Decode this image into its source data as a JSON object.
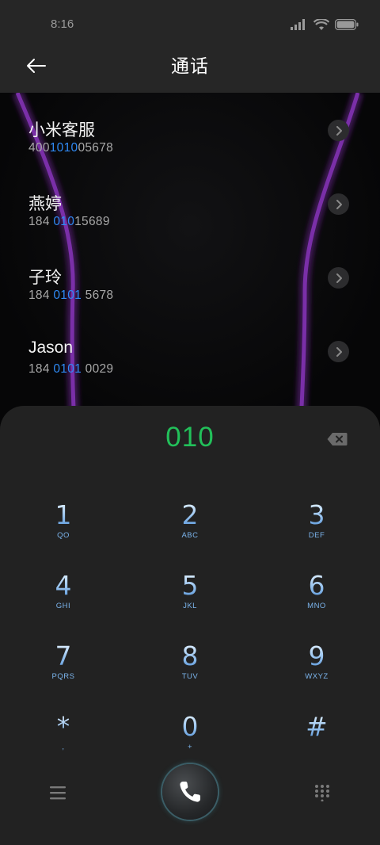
{
  "status_bar": {
    "time": "8:16",
    "icons": [
      "signal-icon",
      "wifi-icon",
      "battery-icon"
    ]
  },
  "header": {
    "title": "通话",
    "back_icon": "back-arrow-icon"
  },
  "contacts": [
    {
      "name": "小米客服",
      "number_before": "400",
      "number_match": "1010",
      "number_after": "05678"
    },
    {
      "name": "燕婷",
      "number_before": "184 ",
      "number_match": "010",
      "number_after": "15689"
    },
    {
      "name": "子玲",
      "number_before": "184 ",
      "number_match": "0101",
      "number_after": " 5678"
    },
    {
      "name": "Jason",
      "number_before": "184 ",
      "number_match": "0101",
      "number_after": " 0029"
    }
  ],
  "dialer": {
    "input": "010",
    "delete_icon": "backspace-icon",
    "keys": [
      {
        "digit": "1",
        "letters": "QO"
      },
      {
        "digit": "2",
        "letters": "ABC"
      },
      {
        "digit": "3",
        "letters": "DEF"
      },
      {
        "digit": "4",
        "letters": "GHI"
      },
      {
        "digit": "5",
        "letters": "JKL"
      },
      {
        "digit": "6",
        "letters": "MNO"
      },
      {
        "digit": "7",
        "letters": "PQRS"
      },
      {
        "digit": "8",
        "letters": "TUV"
      },
      {
        "digit": "9",
        "letters": "WXYZ"
      },
      {
        "digit": "*",
        "letters": ","
      },
      {
        "digit": "0",
        "letters": "+"
      },
      {
        "digit": "#",
        "letters": ""
      }
    ],
    "bottom": {
      "menu_icon": "menu-icon",
      "call_icon": "phone-icon",
      "keypad_icon": "keypad-icon"
    }
  },
  "colors": {
    "highlight": "#2f8af5",
    "dial_input": "#22c05a",
    "key_digit": "#a9cdf2",
    "panel_bg": "#222222",
    "header_bg": "#262626"
  }
}
